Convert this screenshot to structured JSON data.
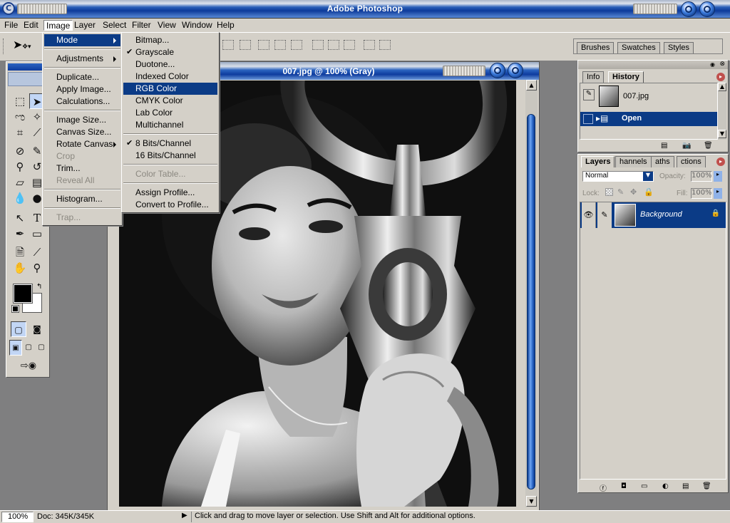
{
  "app": {
    "title": "Adobe Photoshop"
  },
  "menubar": {
    "items": [
      "File",
      "Edit",
      "Image",
      "Layer",
      "Select",
      "Filter",
      "View",
      "Window",
      "Help"
    ]
  },
  "image_menu": {
    "items": [
      {
        "label": "Mode",
        "submenu": true,
        "selected": true
      },
      {
        "label": "Adjustments",
        "submenu": true
      },
      {
        "label": "Duplicate..."
      },
      {
        "label": "Apply Image..."
      },
      {
        "label": "Calculations..."
      },
      {
        "label": "Image Size..."
      },
      {
        "label": "Canvas Size..."
      },
      {
        "label": "Rotate Canvas",
        "submenu": true
      },
      {
        "label": "Crop",
        "disabled": true
      },
      {
        "label": "Trim..."
      },
      {
        "label": "Reveal All",
        "disabled": true
      },
      {
        "label": "Histogram..."
      },
      {
        "label": "Trap...",
        "disabled": true
      }
    ]
  },
  "mode_menu": {
    "items": [
      {
        "label": "Bitmap..."
      },
      {
        "label": "Grayscale",
        "checked": true
      },
      {
        "label": "Duotone..."
      },
      {
        "label": "Indexed Color"
      },
      {
        "label": "RGB Color",
        "highlighted": true
      },
      {
        "label": "CMYK Color"
      },
      {
        "label": "Lab Color"
      },
      {
        "label": "Multichannel"
      },
      {
        "label": "8 Bits/Channel",
        "checked": true
      },
      {
        "label": "16 Bits/Channel"
      },
      {
        "label": "Color Table...",
        "disabled": true
      },
      {
        "label": "Assign Profile..."
      },
      {
        "label": "Convert to Profile..."
      }
    ]
  },
  "palette_well": {
    "tabs": [
      "Brushes",
      "Swatches",
      "Styles"
    ]
  },
  "document": {
    "title": "007.jpg @ 100% (Gray)"
  },
  "history_panel": {
    "tabs": [
      "Info",
      "History"
    ],
    "snapshot": "007.jpg",
    "states": [
      "Open"
    ]
  },
  "layers_panel": {
    "tabs": [
      "Layers",
      "Channels",
      "Paths",
      "Actions"
    ],
    "tab_display": [
      "Layers",
      "hannels",
      "aths",
      "ctions"
    ],
    "blend_mode": "Normal",
    "opacity_label": "Opacity:",
    "opacity": "100%",
    "lock_label": "Lock:",
    "fill_label": "Fill:",
    "fill": "100%",
    "layers": [
      {
        "name": "Background",
        "locked": true
      }
    ]
  },
  "status": {
    "zoom": "100%",
    "doc_size": "Doc: 345K/345K",
    "hint": "Click and drag to move layer or selection.  Use Shift and Alt for additional options."
  }
}
